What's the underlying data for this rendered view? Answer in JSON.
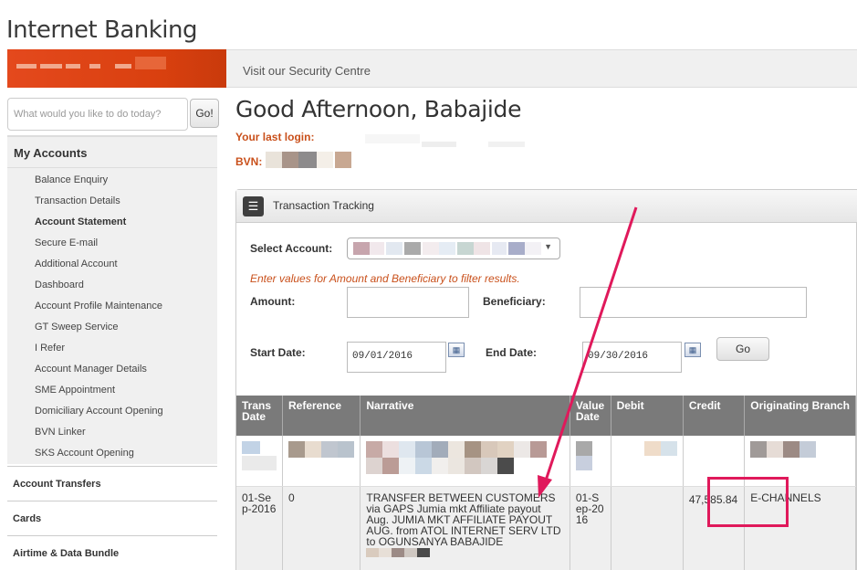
{
  "app": {
    "title": "Internet Banking"
  },
  "header": {
    "security_link": "Visit our Security Centre"
  },
  "sidebar": {
    "search_placeholder": "What would you like to do today?",
    "search_go": "Go!",
    "section_title": "My Accounts",
    "items": [
      {
        "label": "Balance Enquiry"
      },
      {
        "label": "Transaction Details"
      },
      {
        "label": "Account Statement"
      },
      {
        "label": "Secure E-mail"
      },
      {
        "label": "Additional Account"
      },
      {
        "label": "Dashboard"
      },
      {
        "label": "Account Profile Maintenance"
      },
      {
        "label": "GT Sweep Service"
      },
      {
        "label": "I Refer"
      },
      {
        "label": "Account Manager Details"
      },
      {
        "label": "SME Appointment"
      },
      {
        "label": "Domiciliary Account Opening"
      },
      {
        "label": "BVN Linker"
      },
      {
        "label": "SKS Account Opening"
      }
    ],
    "categories": [
      "Account Transfers",
      "Cards",
      "Airtime & Data Bundle"
    ]
  },
  "main": {
    "greeting": "Good Afternoon, Babajide",
    "last_login_label": "Your last login:",
    "bvn_label": "BVN:",
    "panel_title": "Transaction Tracking",
    "select_account_label": "Select Account:",
    "hint": "Enter values for Amount and Beneficiary to filter results.",
    "amount_label": "Amount:",
    "beneficiary_label": "Beneficiary:",
    "start_date_label": "Start Date:",
    "start_date_value": "09/01/2016",
    "end_date_label": "End Date:",
    "end_date_value": "09/30/2016",
    "go_label": "Go"
  },
  "table": {
    "headers": [
      "Trans Date",
      "Reference",
      "Narrative",
      "Value Date",
      "Debit",
      "Credit",
      "Originating Branch"
    ],
    "row": {
      "trans_date": "01-Sep-2016",
      "reference": "0",
      "narrative": "TRANSFER BETWEEN CUSTOMERS via GAPS Jumia mkt Affiliate payout Aug. JUMIA MKT AFFILIATE PAYOUT AUG. from ATOL INTERNET SERV LTD to OGUNSANYA BABAJIDE",
      "value_date": "01-Sep-2016",
      "debit": "",
      "credit": "47,585.84",
      "branch": "E-CHANNELS"
    }
  },
  "colors": {
    "brand": "#e4491d",
    "accent_text": "#c9501b",
    "table_header": "#7a7a7a",
    "annotation": "#e0195b"
  }
}
